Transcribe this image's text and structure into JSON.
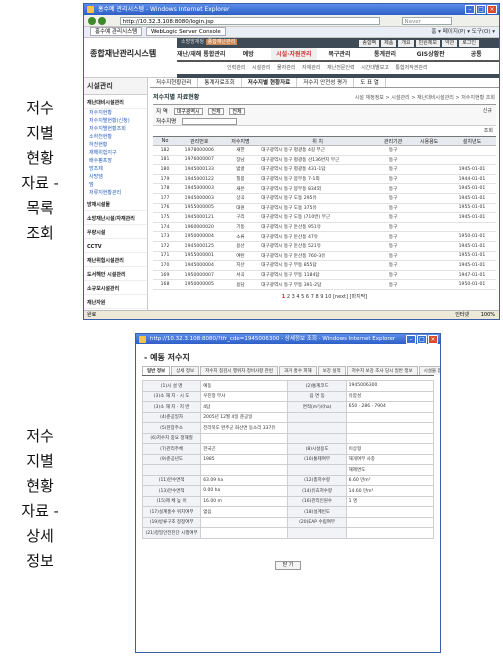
{
  "side_labels": {
    "first": [
      "저수",
      "지별",
      "현황",
      "자료 -",
      "목록",
      "조회"
    ],
    "second": [
      "저수",
      "지별",
      "현황",
      "자료 -",
      "상세",
      "정보"
    ]
  },
  "win1": {
    "title": "홍수예 관리시스템 - Windows Internet Explorer",
    "url": "http://10.32.3.108:8080/login.jsp",
    "search_placeholder": "Naver",
    "tab1": "홍수예 관리시스템",
    "tab2": "WebLogic Server Console",
    "tools": "홈 ▾  페이지(P) ▾  도구(O) ▾",
    "logo": "종합재난관리시스템",
    "top_left": "소방방재청",
    "top_badge": "종합재난관리",
    "top_right": [
      "종합팩",
      "제품",
      "개요",
      "민원제보",
      "약관",
      "로그인"
    ],
    "menus": [
      "재난/재해 통합관리",
      "예방",
      "시설·자원관리",
      "복구관리",
      "통계관리",
      "GIS상황판",
      "공통"
    ],
    "submenu": [
      "인력관리",
      "시설관리",
      "물자관리",
      "자재관리",
      "재난전문인력",
      "시간대별보고",
      "통합저작권관리"
    ],
    "leftnav_title": "시설관리",
    "leftnav": [
      {
        "t": "재난대비시설관리",
        "k": "head"
      },
      {
        "t": "저수지현황",
        "k": "sub"
      },
      {
        "t": "저수지별현황(신청)",
        "k": "sub"
      },
      {
        "t": "저수지별현황조회",
        "k": "sub"
      },
      {
        "t": "소하천현황",
        "k": "sub"
      },
      {
        "t": "하천현황",
        "k": "sub"
      },
      {
        "t": "재해위험지구",
        "k": "sub"
      },
      {
        "t": "배수펌프장",
        "k": "sub"
      },
      {
        "t": "방조제",
        "k": "sub"
      },
      {
        "t": "사방댐",
        "k": "sub"
      },
      {
        "t": "댐",
        "k": "sub"
      },
      {
        "t": "저류지현황관리",
        "k": "sub"
      },
      {
        "t": "방재시설물",
        "k": "head"
      },
      {
        "t": "소방재난시설/자재관리",
        "k": "head"
      },
      {
        "t": "우량시설",
        "k": "head"
      },
      {
        "t": "CCTV",
        "k": "head"
      },
      {
        "t": "재난위험시설관리",
        "k": "head"
      },
      {
        "t": "도서해안 시설관리",
        "k": "head"
      },
      {
        "t": "소규모시설관리",
        "k": "head"
      },
      {
        "t": "재난자원",
        "k": "head"
      }
    ],
    "content_tabs": [
      "저수지현황관리",
      "통계자료조회",
      "저수지별 현황자료",
      "저수지 안전성 평가",
      "도 표 열"
    ],
    "section_title": "저수지별 자료현황",
    "breadcrumb": "시설 재정정보 > 시설관리 > 재난대비시설관리 > 저수지현황 조회",
    "search": {
      "region_label": "지  역",
      "region1": "대구광역시",
      "region2": "전체",
      "region3": "전체",
      "name_label": "저수지명",
      "new_btn": "신규",
      "search_btn": "조회"
    },
    "columns": [
      "No",
      "관리번호",
      "저수지명",
      "위 치",
      "관리기관",
      "시용용도",
      "설치년도"
    ],
    "rows": [
      [
        "182",
        "1978000006",
        "새한",
        "대구광역시 동구 평광동 4길 부근",
        "동구",
        "",
        ""
      ],
      [
        "181",
        "1976000007",
        "장남",
        "대구광역시 동구 평광동 산136번지 부근",
        "동구",
        "",
        ""
      ],
      [
        "180",
        "1945000133",
        "밤골",
        "대구광역시 동구 평광동 431-1답",
        "동구",
        "",
        "1945-01-01"
      ],
      [
        "179",
        "1945000122",
        "칠봉",
        "대구광역시 동구 봉무동 7-1외",
        "동구",
        "",
        "1944-01-01"
      ],
      [
        "178",
        "1945000003",
        "새은",
        "대구광역시 동구 봉무동 834외",
        "동구",
        "",
        "1945-01-01"
      ],
      [
        "177",
        "1945000003",
        "상곡",
        "대구광역시 동구 도동 295유",
        "동구",
        "",
        "1945-01-01"
      ],
      [
        "176",
        "1955000005",
        "대원",
        "대구광역시 동구 도동 375유",
        "동구",
        "",
        "1955-01-01"
      ],
      [
        "175",
        "1945000121",
        "구리",
        "대구광역시 동구 도동 (710번) 부근",
        "동구",
        "",
        "1945-01-01"
      ],
      [
        "174",
        "1960000020",
        "기동",
        "대구광역시 동구 둔산동 951유",
        "동구",
        "",
        ""
      ],
      [
        "173",
        "1950000004",
        "소류",
        "대구광역시 동구 둔산동 47유",
        "동구",
        "",
        "1950-01-01"
      ],
      [
        "172",
        "1945000125",
        "용산",
        "대구광역시 동구 둔산동 521유",
        "동구",
        "",
        "1945-01-01"
      ],
      [
        "171",
        "1955000001",
        "여탄",
        "대구광역시 동구 둔산동 760-3유",
        "동구",
        "",
        "1955-01-01"
      ],
      [
        "170",
        "1945000004",
        "지산",
        "대구광역시 동구 부동 855답",
        "동구",
        "",
        "1945-01-01"
      ],
      [
        "169",
        "1950000007",
        "서곡",
        "대구광역시 동구 부동 1184답",
        "동구",
        "",
        "1947-01-01"
      ],
      [
        "168",
        "1950000005",
        "용담",
        "대구광역시 동구 부동 391-2답",
        "동구",
        "",
        "1950-01-01"
      ]
    ],
    "pager_current": "1",
    "pager": "2 3 4 5 6 7 8 9 10 [next] [마지막]",
    "status_left": "완료",
    "status_zone": "인터넷",
    "status_zoom": "100%"
  },
  "win2": {
    "title": "http://10.32.3.108:8080/?tfr_cde=1945006300 - 상세정보 조회 - Windows Internet Explorer",
    "heading": "- 예동 저수지",
    "tabs": [
      "일반 정보",
      "상세 정보",
      "저수지 점검시 행위자 정비사항 관련",
      "과거 홍수 피해",
      "보강 실적",
      "저수지 보강 조사 당시 일반 정보",
      "시설물 점검 결과",
      "현황 사진"
    ],
    "fields": [
      [
        "(1)시 설 명",
        "예동",
        "(2)통계코드",
        "1945006300"
      ],
      [
        "(3)소 재 지 · 시 도",
        "우진정 부사",
        "읍 면 동",
        "유함성"
      ],
      [
        "(3)소 재 지 · 지 번",
        "4답",
        "면적(m²)/(ha)",
        "650 · 286 · 7904"
      ],
      [
        "(4)준공일자",
        "2005년 12월 4일 준공일",
        "",
        ""
      ],
      [
        "(5)현장주소",
        "전라북도 완주군 화산면 동소리 337유",
        "",
        ""
      ],
      [
        "(6)저수지 중요 정해질",
        "",
        "",
        ""
      ],
      [
        "(7)관리주체",
        "한국곤",
        "(8)시설용도",
        "이상형"
      ],
      [
        "(9)준공년도",
        "1985",
        "(10)통제여부",
        "해게여부 사종"
      ],
      [
        "",
        "",
        "",
        "해제면도"
      ],
      [
        "(11)만수면적",
        "63.09 ha",
        "(12)총저수량",
        "6.60 만m³"
      ],
      [
        "(13)만수면적",
        "0.00 ha",
        "(14)유효저수량",
        "14.60 만m³"
      ],
      [
        "(15)제 체 높 이",
        "16.00 m",
        "(16)관리인원수",
        "1 명"
      ],
      [
        "(17)설계홍수 위치여부",
        "없음",
        "(18)설계빈도",
        ""
      ],
      [
        "(19)방류구조 정정여부",
        "",
        "(20)EAP 수립여부",
        ""
      ],
      [
        "(21)정밀안전진단 시행여부",
        "",
        "",
        ""
      ]
    ],
    "close": "닫 기"
  }
}
